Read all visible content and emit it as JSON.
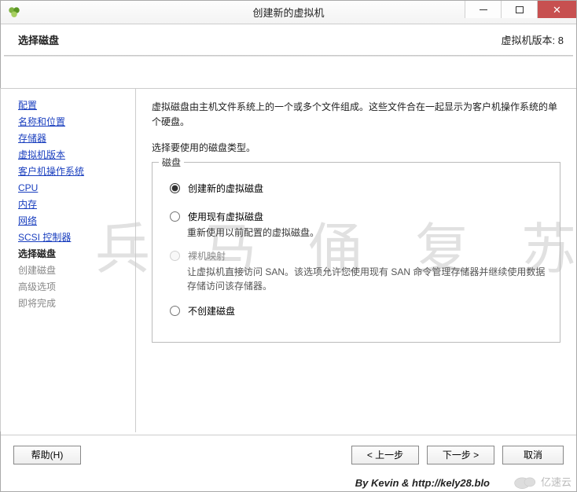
{
  "window": {
    "title": "创建新的虚拟机"
  },
  "header": {
    "left": "选择磁盘",
    "right": "虚拟机版本: 8"
  },
  "sidebar": {
    "items": [
      {
        "label": "配置",
        "state": "link"
      },
      {
        "label": "名称和位置",
        "state": "link"
      },
      {
        "label": "存储器",
        "state": "link"
      },
      {
        "label": "虚拟机版本",
        "state": "link"
      },
      {
        "label": "客户机操作系统",
        "state": "link"
      },
      {
        "label": "CPU",
        "state": "link"
      },
      {
        "label": "内存",
        "state": "link"
      },
      {
        "label": "网络",
        "state": "link"
      },
      {
        "label": "SCSI 控制器",
        "state": "link"
      },
      {
        "label": "选择磁盘",
        "state": "current"
      },
      {
        "label": "创建磁盘",
        "state": "disabled"
      },
      {
        "label": "高级选项",
        "state": "disabled"
      },
      {
        "label": "即将完成",
        "state": "disabled"
      }
    ]
  },
  "content": {
    "desc": "虚拟磁盘由主机文件系统上的一个或多个文件组成。这些文件合在一起显示为客户机操作系统的单个硬盘。",
    "subdesc": "选择要使用的磁盘类型。",
    "group_title": "磁盘",
    "options": [
      {
        "label": "创建新的虚拟磁盘",
        "hint": "",
        "checked": true,
        "disabled": false
      },
      {
        "label": "使用现有虚拟磁盘",
        "hint": "重新使用以前配置的虚拟磁盘。",
        "checked": false,
        "disabled": false
      },
      {
        "label": "裸机映射",
        "hint": "让虚拟机直接访问 SAN。该选项允许您使用现有 SAN 命令管理存储器并继续使用数据存储访问该存储器。",
        "checked": false,
        "disabled": true
      },
      {
        "label": "不创建磁盘",
        "hint": "",
        "checked": false,
        "disabled": false
      }
    ]
  },
  "footer": {
    "help": "帮助(H)",
    "back": "< 上一步",
    "next": "下一步 >",
    "cancel": "取消"
  },
  "credits": "By Kevin & http://kely28.blo",
  "watermark_logo": "亿速云",
  "watermark_bg": "兵 马 俑 复 苏"
}
